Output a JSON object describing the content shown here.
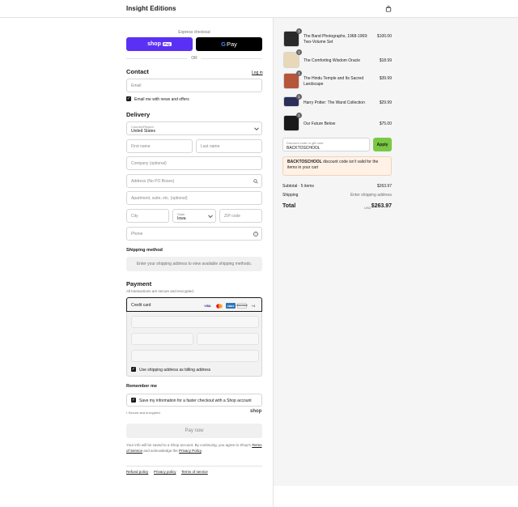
{
  "header": {
    "brand": "Insight Editions",
    "cart_icon": "shopping-bag-icon"
  },
  "express": {
    "label": "Express checkout",
    "shop_pay": "shop",
    "shop_pay_badge": "Pay",
    "gpay_g": "G",
    "gpay": "Pay",
    "or": "OR"
  },
  "contact": {
    "title": "Contact",
    "login": "Log in",
    "email_placeholder": "Email",
    "news_label": "Email me with news and offers",
    "news_checked": true
  },
  "delivery": {
    "title": "Delivery",
    "country_label": "Country/Region",
    "country_value": "United States",
    "first_name": "First name",
    "last_name": "Last name",
    "company": "Company (optional)",
    "address": "Address (No PO Boxes)",
    "apartment": "Apartment, suite, etc. (optional)",
    "city": "City",
    "state_label": "State",
    "state_value": "Iowa",
    "zip": "ZIP code",
    "phone": "Phone"
  },
  "shipping_method": {
    "title": "Shipping method",
    "message": "Enter your shipping address to view available shipping methods."
  },
  "payment": {
    "title": "Payment",
    "subtitle": "All transactions are secure and encrypted.",
    "credit_card": "Credit card",
    "card_logos": [
      "VISA",
      "MC",
      "AMEX",
      "DISCOVER",
      "+4"
    ],
    "billing_label": "Use shipping address as billing address",
    "billing_checked": true
  },
  "remember": {
    "title": "Remember me",
    "save_label": "Save my information for a faster checkout with a Shop account",
    "secure": "Secure and encrypted",
    "shop_logo": "shop"
  },
  "pay_now": "Pay now",
  "legal": {
    "prefix": "Your info will be saved to a Shop account. By continuing, you agree to Shop's",
    "terms": "Terms of Service",
    "middle": "and acknowledge the",
    "privacy": "Privacy Policy",
    "suffix": "."
  },
  "footer_links": [
    "Refund policy",
    "Privacy policy",
    "Terms of service"
  ],
  "cart": {
    "items": [
      {
        "name": "The Band Photographs, 1968-1969: Two-Volume Set",
        "price": "$100.00",
        "qty": "1",
        "color": "#2a2a2a"
      },
      {
        "name": "The Comforting Wisdom Oracle",
        "price": "$18.99",
        "qty": "1",
        "color": "#e9d8b8"
      },
      {
        "name": "The Hindu Temple and Its Sacred Landscape",
        "price": "$39.99",
        "qty": "1",
        "color": "#b5553a"
      },
      {
        "name": "Harry Potter: The Wand Collection",
        "price": "$29.99",
        "qty": "1",
        "color": "#2b2f5a"
      },
      {
        "name": "Our Future Below",
        "price": "$75.00",
        "qty": "1",
        "color": "#1a1a1a"
      }
    ],
    "discount_label": "Discount code or gift card",
    "discount_value": "BACKTOSCHOOL",
    "apply": "Apply",
    "alert_code": "BACKTOSCHOOL",
    "alert_text": " discount code isn't valid for the items in your cart",
    "subtotal_label": "Subtotal · 5 items",
    "subtotal_value": "$263.97",
    "shipping_label": "Shipping",
    "shipping_value": "Enter shipping address",
    "total_label": "Total",
    "currency": "USD",
    "total_value": "$263.97"
  },
  "colors": {
    "shop_purple": "#5a31f4",
    "apply_green": "#7ac943",
    "alert_bg": "#fff1e6"
  }
}
